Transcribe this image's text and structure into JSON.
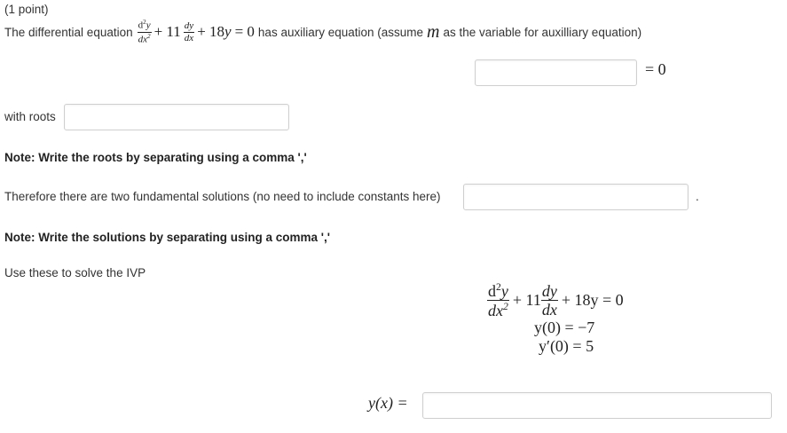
{
  "header": {
    "points": "(1 point)"
  },
  "question": {
    "intro": "The differential equation",
    "eq": {
      "d2": "d",
      "y": "y",
      "dx": "dx",
      "two": "2",
      "plus11": "+ 11",
      "dy": "dy",
      "dx2": "dx",
      "plus18": "+ 18",
      "eq0": "= 0"
    },
    "mid": "has auxiliary equation (assume",
    "m": "m",
    "end": "as the variable for auxilliary equation)"
  },
  "aux": {
    "equals": "= 0",
    "value": ""
  },
  "roots": {
    "label": "with roots",
    "value": ""
  },
  "note1": "Note: Write the roots by separating using a comma ','",
  "fund": {
    "label": "Therefore there are two fundamental solutions (no need to include constants here)",
    "period": ".",
    "value": ""
  },
  "note2": "Note: Write the solutions by separating using a comma ','",
  "ivp": {
    "label": "Use these to solve the IVP",
    "line1_rest": "+ 18y = 0",
    "plus11": "+ 11",
    "line2": "y(0) = −7",
    "line3": "y′(0) = 5"
  },
  "answer": {
    "lhs": "y(x) =",
    "value": ""
  }
}
